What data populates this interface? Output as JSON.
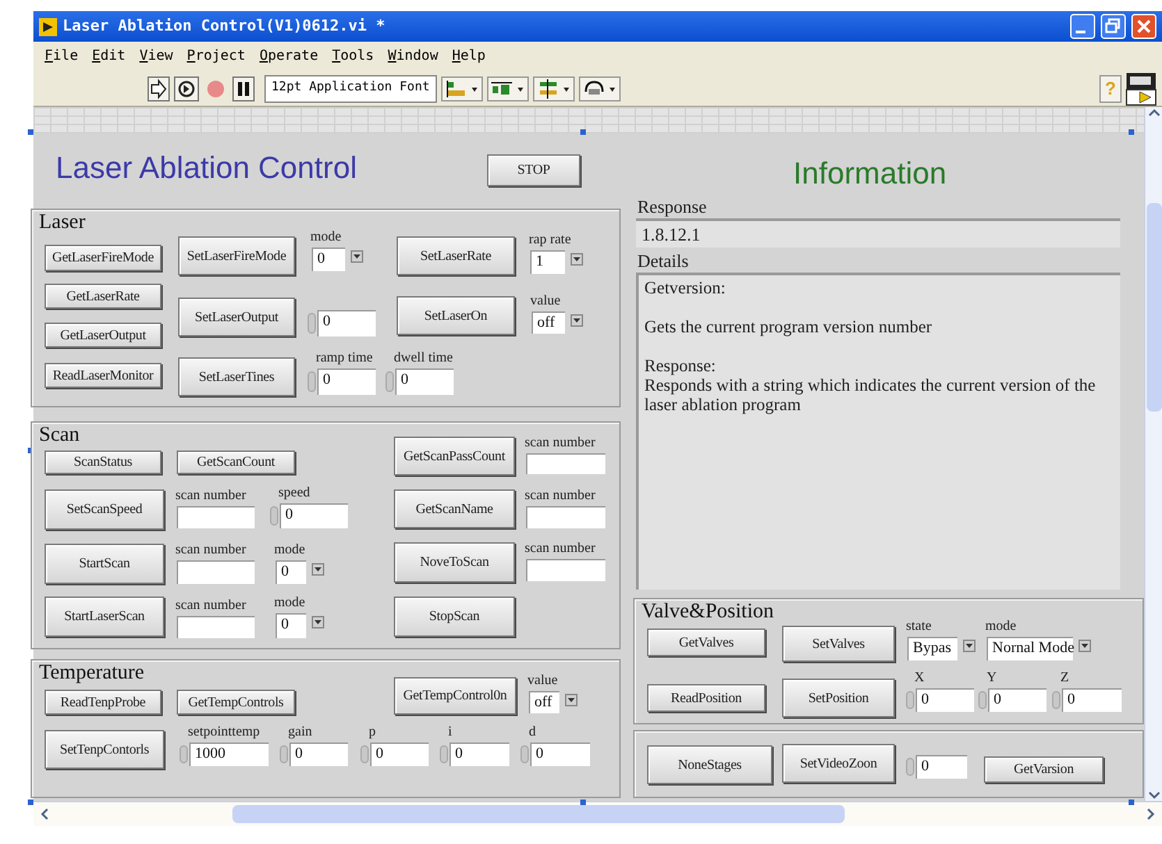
{
  "window": {
    "title": "Laser Ablation Control(V1)0612.vi *"
  },
  "menu": [
    "File",
    "Edit",
    "View",
    "Project",
    "Operate",
    "Tools",
    "Window",
    "Help"
  ],
  "toolbar": {
    "font": "12pt Application Font",
    "help": "?"
  },
  "panel": {
    "title": "Laser Ablation Control",
    "stop_button": "STOP",
    "info_title": "Information",
    "response": {
      "label": "Response",
      "value": "1.8.12.1"
    },
    "details": {
      "label": "Details",
      "paragraphs": [
        "Getversion:",
        "Gets the current program version number",
        "Response:\nResponds with a string which indicates the current version of the laser ablation program"
      ]
    },
    "sections": [
      {
        "title": "Laser",
        "controls": [
          {
            "kind": "button",
            "label": "GetLaserFireMode"
          },
          {
            "kind": "button",
            "label": "GetLaserRate"
          },
          {
            "kind": "button",
            "label": "GetLaserOutput"
          },
          {
            "kind": "button",
            "label": "ReadLaserMonitor"
          },
          {
            "kind": "button",
            "label": "SetLaserFireMode"
          },
          {
            "kind": "ring",
            "label": "mode",
            "value": "0"
          },
          {
            "kind": "button",
            "label": "SetLaserRate"
          },
          {
            "kind": "ring",
            "label": "rap rate",
            "value": "1"
          },
          {
            "kind": "button",
            "label": "SetLaserOutput"
          },
          {
            "kind": "numeric",
            "value": "0"
          },
          {
            "kind": "button",
            "label": "SetLaserOn"
          },
          {
            "kind": "ring",
            "label": "value",
            "value": "off"
          },
          {
            "kind": "button",
            "label": "SetLaserTines"
          },
          {
            "kind": "numeric",
            "label": "ramp time",
            "value": "0"
          },
          {
            "kind": "numeric",
            "label": "dwell time",
            "value": "0"
          }
        ]
      },
      {
        "title": "Scan",
        "controls": [
          {
            "kind": "button",
            "label": "ScanStatus"
          },
          {
            "kind": "button",
            "label": "GetScanCount"
          },
          {
            "kind": "button",
            "label": "GetScanPassCount"
          },
          {
            "kind": "string",
            "label": "scan number"
          },
          {
            "kind": "button",
            "label": "SetScanSpeed"
          },
          {
            "kind": "string",
            "label": "scan number"
          },
          {
            "kind": "numeric",
            "label": "speed",
            "value": "0"
          },
          {
            "kind": "button",
            "label": "GetScanName"
          },
          {
            "kind": "string",
            "label": "scan number"
          },
          {
            "kind": "button",
            "label": "StartScan"
          },
          {
            "kind": "string",
            "label": "scan number"
          },
          {
            "kind": "ring",
            "label": "mode",
            "value": "0"
          },
          {
            "kind": "button",
            "label": "NoveToScan"
          },
          {
            "kind": "string",
            "label": "scan number"
          },
          {
            "kind": "button",
            "label": "StartLaserScan"
          },
          {
            "kind": "string",
            "label": "scan number"
          },
          {
            "kind": "ring",
            "label": "mode",
            "value": "0"
          },
          {
            "kind": "button",
            "label": "StopScan"
          }
        ]
      },
      {
        "title": "Temperature",
        "controls": [
          {
            "kind": "button",
            "label": "ReadTenpProbe"
          },
          {
            "kind": "button",
            "label": "GetTempControls"
          },
          {
            "kind": "button",
            "label": "GetTempControl0n"
          },
          {
            "kind": "ring",
            "label": "value",
            "value": "off"
          },
          {
            "kind": "button",
            "label": "SetTenpContorls"
          },
          {
            "kind": "numeric",
            "label": "setpointtemp",
            "value": "1000"
          },
          {
            "kind": "numeric",
            "label": "gain",
            "value": "0"
          },
          {
            "kind": "numeric",
            "label": "p",
            "value": "0"
          },
          {
            "kind": "numeric",
            "label": "i",
            "value": "0"
          },
          {
            "kind": "numeric",
            "label": "d",
            "value": "0"
          }
        ]
      },
      {
        "title": "Valve&Position",
        "controls": [
          {
            "kind": "button",
            "label": "GetValves"
          },
          {
            "kind": "button",
            "label": "SetValves"
          },
          {
            "kind": "ring",
            "label": "state",
            "value": "Bypas"
          },
          {
            "kind": "ring",
            "label": "mode",
            "value": "Nornal Mode"
          },
          {
            "kind": "button",
            "label": "ReadPosition"
          },
          {
            "kind": "button",
            "label": "SetPosition"
          },
          {
            "kind": "numeric",
            "label": "X",
            "value": "0"
          },
          {
            "kind": "numeric",
            "label": "Y",
            "value": "0"
          },
          {
            "kind": "numeric",
            "label": "Z",
            "value": "0"
          }
        ]
      },
      {
        "controls": [
          {
            "kind": "button",
            "label": "NoneStages"
          },
          {
            "kind": "button",
            "label": "SetVideoZoon"
          },
          {
            "kind": "numeric",
            "value": "0"
          },
          {
            "kind": "button",
            "label": "GetVarsion"
          }
        ]
      }
    ]
  }
}
